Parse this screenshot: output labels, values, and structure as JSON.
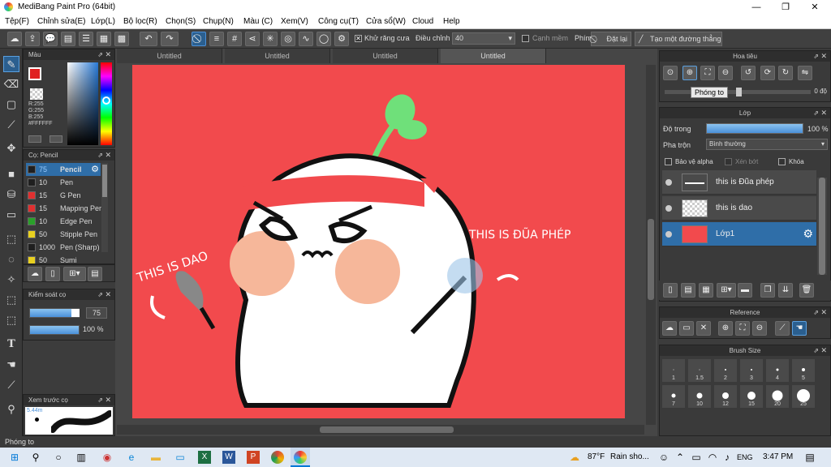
{
  "app": {
    "title": "MediBang Paint Pro (64bit)"
  },
  "window": {
    "minimize": "—",
    "maximize": "❐",
    "close": "✕"
  },
  "menu": [
    "Tệp(F)",
    "Chỉnh sửa(E)",
    "Lớp(L)",
    "Bộ lọc(R)",
    "Chọn(S)",
    "Chụp(N)",
    "Màu (C)",
    "Xem(V)",
    "Công cụ(T)",
    "Cửa sổ(W)",
    "Cloud",
    "Help"
  ],
  "toolbar": {
    "antialias": "Khử răng cưa",
    "adjust_label": "Điều chỉnh",
    "adjust_value": "40",
    "soft_edge": "Cạnh mềm",
    "key_label": "Phím",
    "reset": "Đặt lại",
    "straight_line": "Tạo một đường thẳng"
  },
  "color_panel": {
    "title": "Màu",
    "r": "R:255",
    "g": "G:255",
    "b": "B:255",
    "hex": "#FFFFFF"
  },
  "brush_panel": {
    "title": "Cọ: Pencil",
    "items": [
      {
        "size": "75",
        "name": "Pencil",
        "color": "#1f1f1f"
      },
      {
        "size": "10",
        "name": "Pen",
        "color": "#1f1f1f"
      },
      {
        "size": "15",
        "name": "G Pen",
        "color": "#e03030"
      },
      {
        "size": "15",
        "name": "Mapping Pen",
        "color": "#e03030"
      },
      {
        "size": "10",
        "name": "Edge Pen",
        "color": "#2aa02a"
      },
      {
        "size": "50",
        "name": "Stipple Pen",
        "color": "#e8d020"
      },
      {
        "size": "1000",
        "name": "Pen (Sharp)",
        "color": "#1f1f1f"
      },
      {
        "size": "50",
        "name": "Sumi",
        "color": "#e8d020"
      }
    ]
  },
  "brush_control": {
    "title": "Kiểm soát cọ",
    "size": "75",
    "opacity": "100 %"
  },
  "preview": {
    "title": "Xem trước cọ",
    "size": "5.44m"
  },
  "tabs": [
    "Untitled",
    "Untitled",
    "Untitled",
    "Untitled"
  ],
  "canvas": {
    "text_dao": "THIS IS DAO",
    "text_dua": "THIS IS ĐŨA PHÉP",
    "bg": "#f24a4d"
  },
  "navigator": {
    "title": "Hoa tiêu",
    "zoom_tooltip": "Phóng to",
    "angle": "0 độ"
  },
  "layer_panel": {
    "title": "Lớp",
    "opacity_label": "Độ trong",
    "opacity_value": "100 %",
    "opacity_fraction": 1.0,
    "blend_label": "Pha trộn",
    "blend_value": "Bình thường",
    "protect_alpha": "Bảo vệ alpha",
    "clipping": "Xén bớt",
    "lock": "Khóa",
    "layers": [
      {
        "name": "this is Đũa phép",
        "active": false
      },
      {
        "name": "this is dao",
        "active": false
      },
      {
        "name": "Lớp1",
        "active": true
      }
    ]
  },
  "reference_panel": {
    "title": "Reference"
  },
  "brush_size_panel": {
    "title": "Brush Size",
    "sizes": [
      "1",
      "1.5",
      "2",
      "3",
      "4",
      "5",
      "7",
      "10",
      "12",
      "15",
      "20",
      "25"
    ]
  },
  "status": {
    "text": "Phóng to"
  },
  "taskbar": {
    "weather_temp": "87°F",
    "weather_text": "Rain sho...",
    "lang": "ENG",
    "time": "3:47 PM"
  }
}
